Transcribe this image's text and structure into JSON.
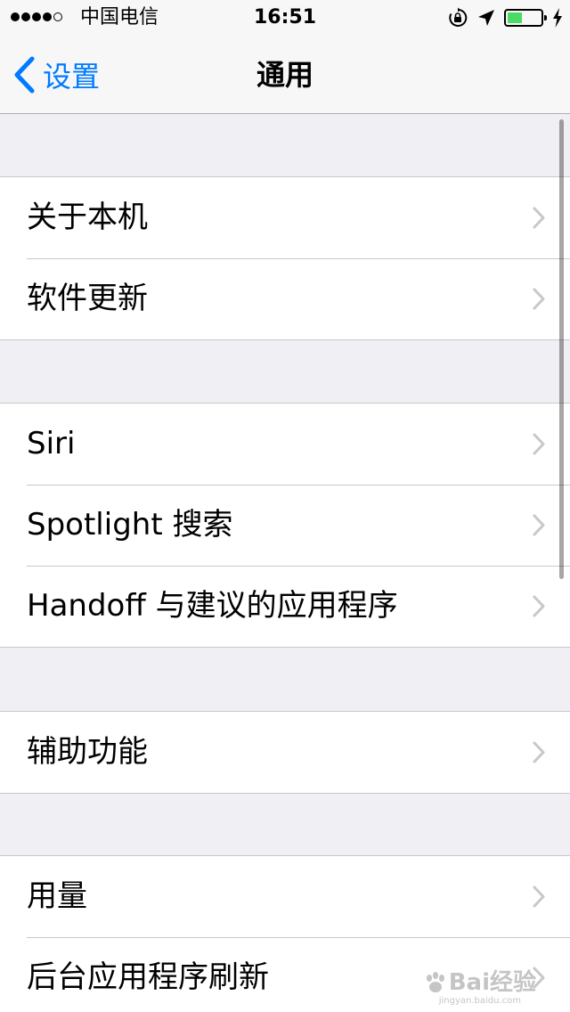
{
  "status_bar": {
    "carrier": "中国电信",
    "time": "16:51",
    "signal_bars_filled": 4,
    "signal_bars_total": 5,
    "battery_level": 0.45,
    "battery_color": "#4cd964",
    "icons": [
      "orientation-lock-icon",
      "location-arrow-icon",
      "battery-icon",
      "charging-bolt-icon"
    ]
  },
  "nav": {
    "back_label": "设置",
    "title": "通用",
    "accent_color": "#007aff"
  },
  "groups": [
    {
      "rows": [
        {
          "label": "关于本机"
        },
        {
          "label": "软件更新"
        }
      ]
    },
    {
      "rows": [
        {
          "label": "Siri"
        },
        {
          "label": "Spotlight 搜索"
        },
        {
          "label": "Handoff 与建议的应用程序"
        }
      ]
    },
    {
      "rows": [
        {
          "label": "辅助功能"
        }
      ]
    },
    {
      "rows": [
        {
          "label": "用量"
        },
        {
          "label": "后台应用程序刷新"
        }
      ]
    }
  ],
  "watermark": {
    "main": "Bai经验",
    "sub": "jingyan.baidu.com"
  }
}
